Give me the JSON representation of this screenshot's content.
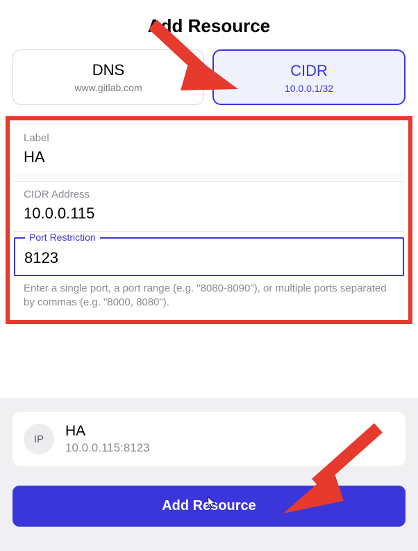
{
  "header": {
    "title": "Add Resource"
  },
  "tabs": {
    "dns": {
      "label": "DNS",
      "example": "www.gitlab.com"
    },
    "cidr": {
      "label": "CIDR",
      "example": "10.0.0.1/32"
    }
  },
  "form": {
    "label_field": {
      "label": "Label",
      "value": "HA"
    },
    "cidr_field": {
      "label": "CIDR Address",
      "value": "10.0.0.115"
    },
    "port_field": {
      "label": "Port Restriction",
      "value": "8123"
    },
    "port_helper": "Enter a single port, a port range (e.g. \"8080-8090\"), or multiple ports separated by commas (e.g. \"8000, 8080\")."
  },
  "preview": {
    "badge": "IP",
    "title": "HA",
    "subtitle": "10.0.0.115:8123"
  },
  "actions": {
    "submit": "Add Resource"
  }
}
